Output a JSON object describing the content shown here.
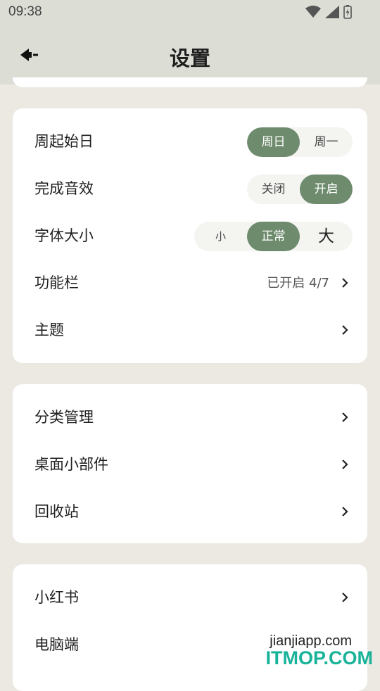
{
  "status_bar": {
    "time": "09:38"
  },
  "app_bar": {
    "title": "设置"
  },
  "section1": {
    "week_start": {
      "label": "周起始日",
      "options": [
        "周日",
        "周一"
      ],
      "selected": "周日"
    },
    "sound": {
      "label": "完成音效",
      "options": [
        "关闭",
        "开启"
      ],
      "selected": "开启"
    },
    "font_size": {
      "label": "字体大小",
      "options": [
        "小",
        "正常",
        "大"
      ],
      "selected": "正常"
    },
    "toolbar": {
      "label": "功能栏",
      "value": "已开启 4/7"
    },
    "theme": {
      "label": "主题"
    }
  },
  "section2": {
    "category": {
      "label": "分类管理"
    },
    "widget": {
      "label": "桌面小部件"
    },
    "recycle": {
      "label": "回收站"
    }
  },
  "section3": {
    "xiaohongshu": {
      "label": "小红书"
    },
    "desktop": {
      "label": "电脑端"
    }
  },
  "watermark": {
    "site": "jianjiapp.com",
    "brand": "ITMOP.COM"
  },
  "colors": {
    "accent": "#6e8b6e",
    "appbar": "#dcddd5",
    "background": "#ebe9e2"
  }
}
